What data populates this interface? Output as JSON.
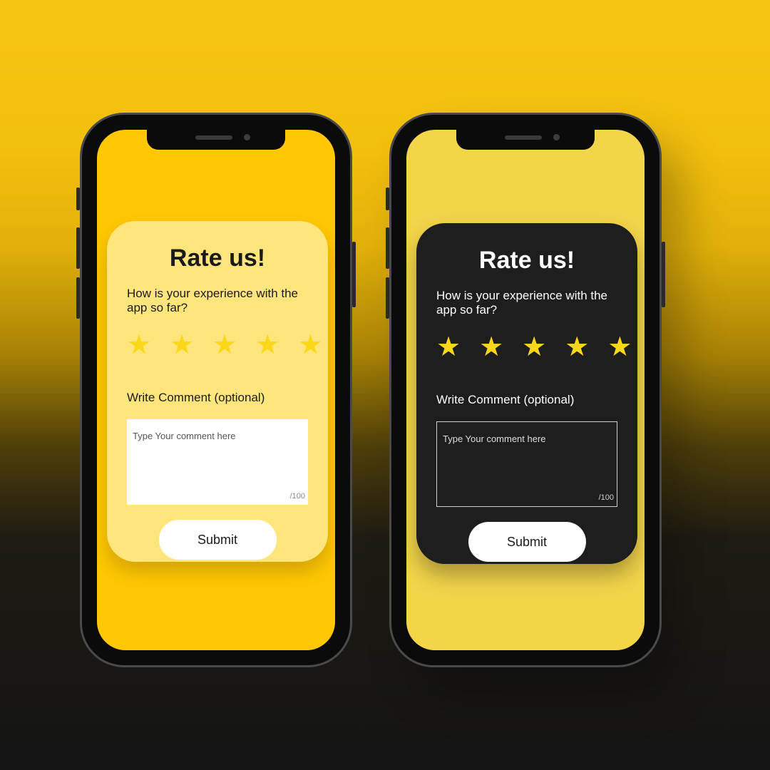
{
  "colors": {
    "light_screen": "#ffc803",
    "light_card": "#ffe57c",
    "dark_screen": "#f3d54a",
    "dark_card": "#1e1e1e",
    "star": "#fbd817"
  },
  "phones": [
    {
      "theme": "light",
      "card": {
        "title": "Rate us!",
        "question": "How is your experience with the app so far?",
        "stars": [
          "★",
          "★",
          "★",
          "★",
          "★"
        ],
        "comment_label": "Write Comment (optional)",
        "comment_placeholder": "Type Your comment here",
        "char_counter": "/100",
        "submit_label": "Submit"
      }
    },
    {
      "theme": "dark",
      "card": {
        "title": "Rate us!",
        "question": "How is your experience with the app so far?",
        "stars": [
          "★",
          "★",
          "★",
          "★",
          "★"
        ],
        "comment_label": "Write Comment (optional)",
        "comment_placeholder": "Type Your comment here",
        "char_counter": "/100",
        "submit_label": "Submit"
      }
    }
  ]
}
